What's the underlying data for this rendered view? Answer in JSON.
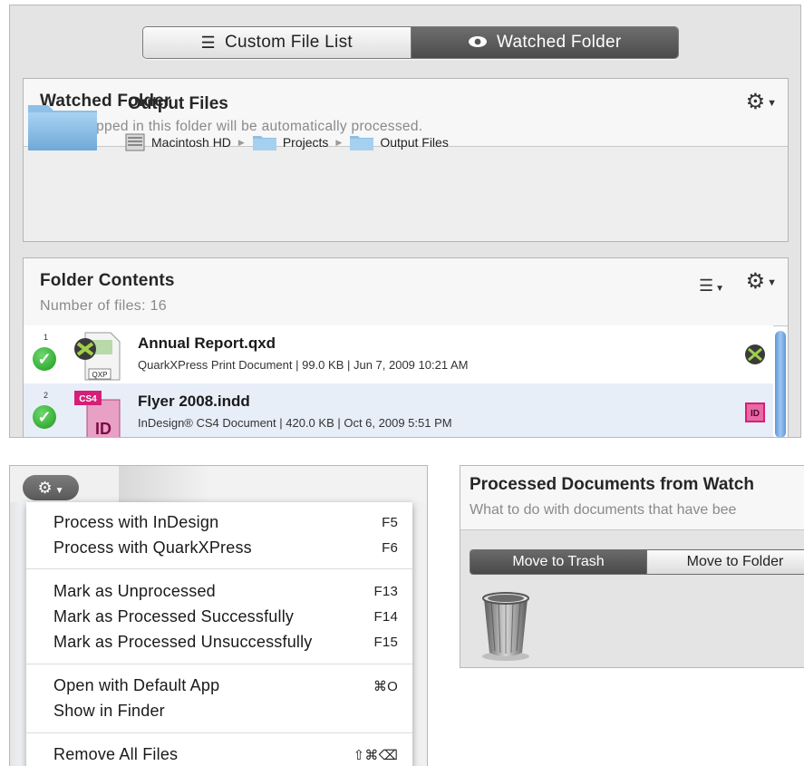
{
  "view_switcher": {
    "custom_label": "Custom File List",
    "watched_label": "Watched Folder",
    "selected": "Watched Folder"
  },
  "watched_folder": {
    "title": "Watched Folder",
    "subtitle": "Files dropped in this folder will be automatically processed.",
    "folder_name": "Output Files",
    "path": [
      "Macintosh HD",
      "Projects",
      "Output Files"
    ]
  },
  "folder_contents": {
    "title": "Folder Contents",
    "count_label": "Number of files: 16",
    "files": [
      {
        "index": "1",
        "name": "Annual Report.qxd",
        "meta": "QuarkXPress Print Document | 99.0 KB | Jun 7, 2009 10:21 AM",
        "icon_label": "QXP"
      },
      {
        "index": "2",
        "name": "Flyer 2008.indd",
        "meta": "InDesign® CS4 Document | 420.0 KB | Oct 6, 2009 5:51 PM",
        "icon_label": "ID",
        "badge_label": "CS4",
        "app_badge": "ID"
      }
    ]
  },
  "context_menu": {
    "items": [
      {
        "label": "Process with InDesign",
        "shortcut": "F5"
      },
      {
        "label": "Process with QuarkXPress",
        "shortcut": "F6"
      },
      {
        "label": "Mark as Unprocessed",
        "shortcut": "F13"
      },
      {
        "label": "Mark as Processed Successfully",
        "shortcut": "F14"
      },
      {
        "label": "Mark as Processed Unsuccessfully",
        "shortcut": "F15"
      },
      {
        "label": "Open with Default App",
        "shortcut": "⌘O"
      },
      {
        "label": "Show in Finder",
        "shortcut": ""
      },
      {
        "label": "Remove All Files",
        "shortcut": "⇧⌘⌫"
      }
    ]
  },
  "processed": {
    "title": "Processed Documents from Watch",
    "subtitle": "What to do with documents that have bee",
    "trash_label": "Move to Trash",
    "folder_label": "Move to Folder",
    "selected": "Move to Trash"
  },
  "icons": {
    "list": "list-icon",
    "eye": "eye-icon",
    "gear": "gear-icon",
    "sort": "sort-icon",
    "folder": "folder-icon",
    "harddrive": "hard-drive-icon",
    "trash": "trash-can-icon"
  },
  "colors": {
    "selected_segment": "#555555",
    "selected_row": "#e8eef8",
    "check_green": "#1c9a1c",
    "scroll_blue": "#5d97dc",
    "indesign_pink": "#d61f78"
  }
}
